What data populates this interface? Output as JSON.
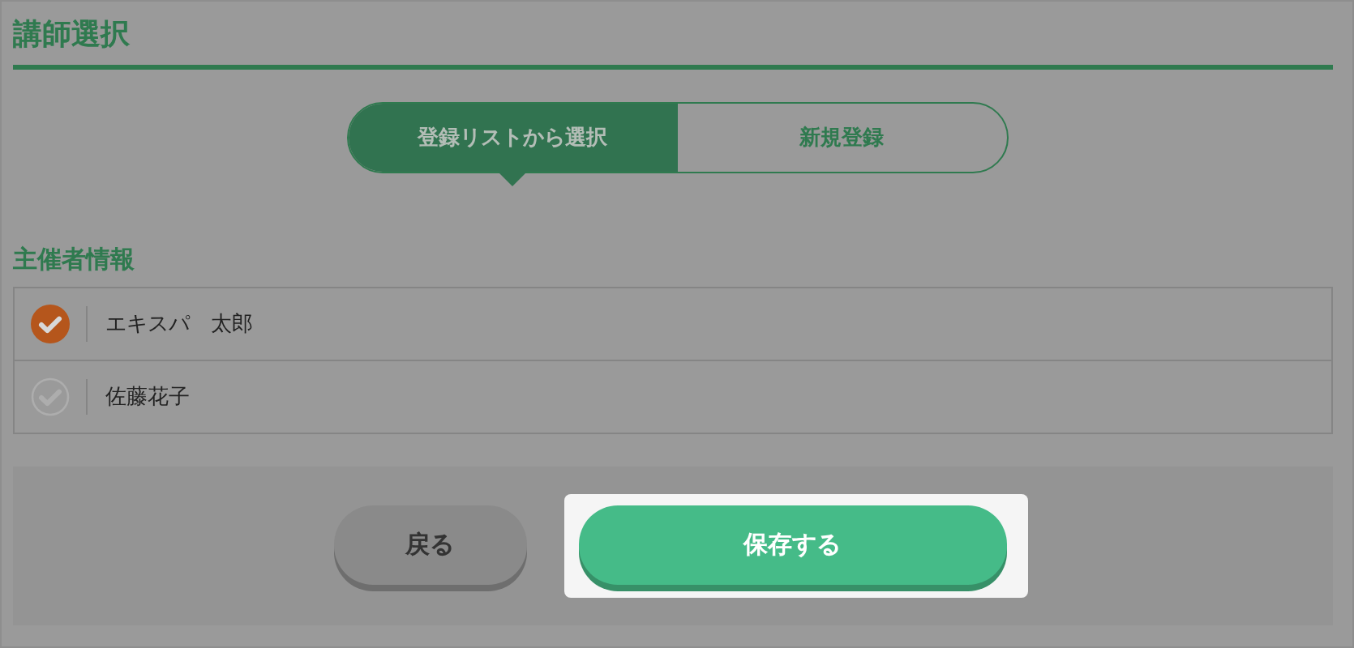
{
  "title": "講師選択",
  "tabs": [
    {
      "label": "登録リストから選択",
      "selected": true
    },
    {
      "label": "新規登録",
      "selected": false
    }
  ],
  "section_title": "主催者情報",
  "organizers": [
    {
      "name": "エキスパ　太郎",
      "selected": true
    },
    {
      "name": "佐藤花子",
      "selected": false
    }
  ],
  "buttons": [
    {
      "label": "戻る",
      "kind": "secondary",
      "highlighted": false
    },
    {
      "label": "保存する",
      "kind": "primary",
      "highlighted": true
    }
  ]
}
